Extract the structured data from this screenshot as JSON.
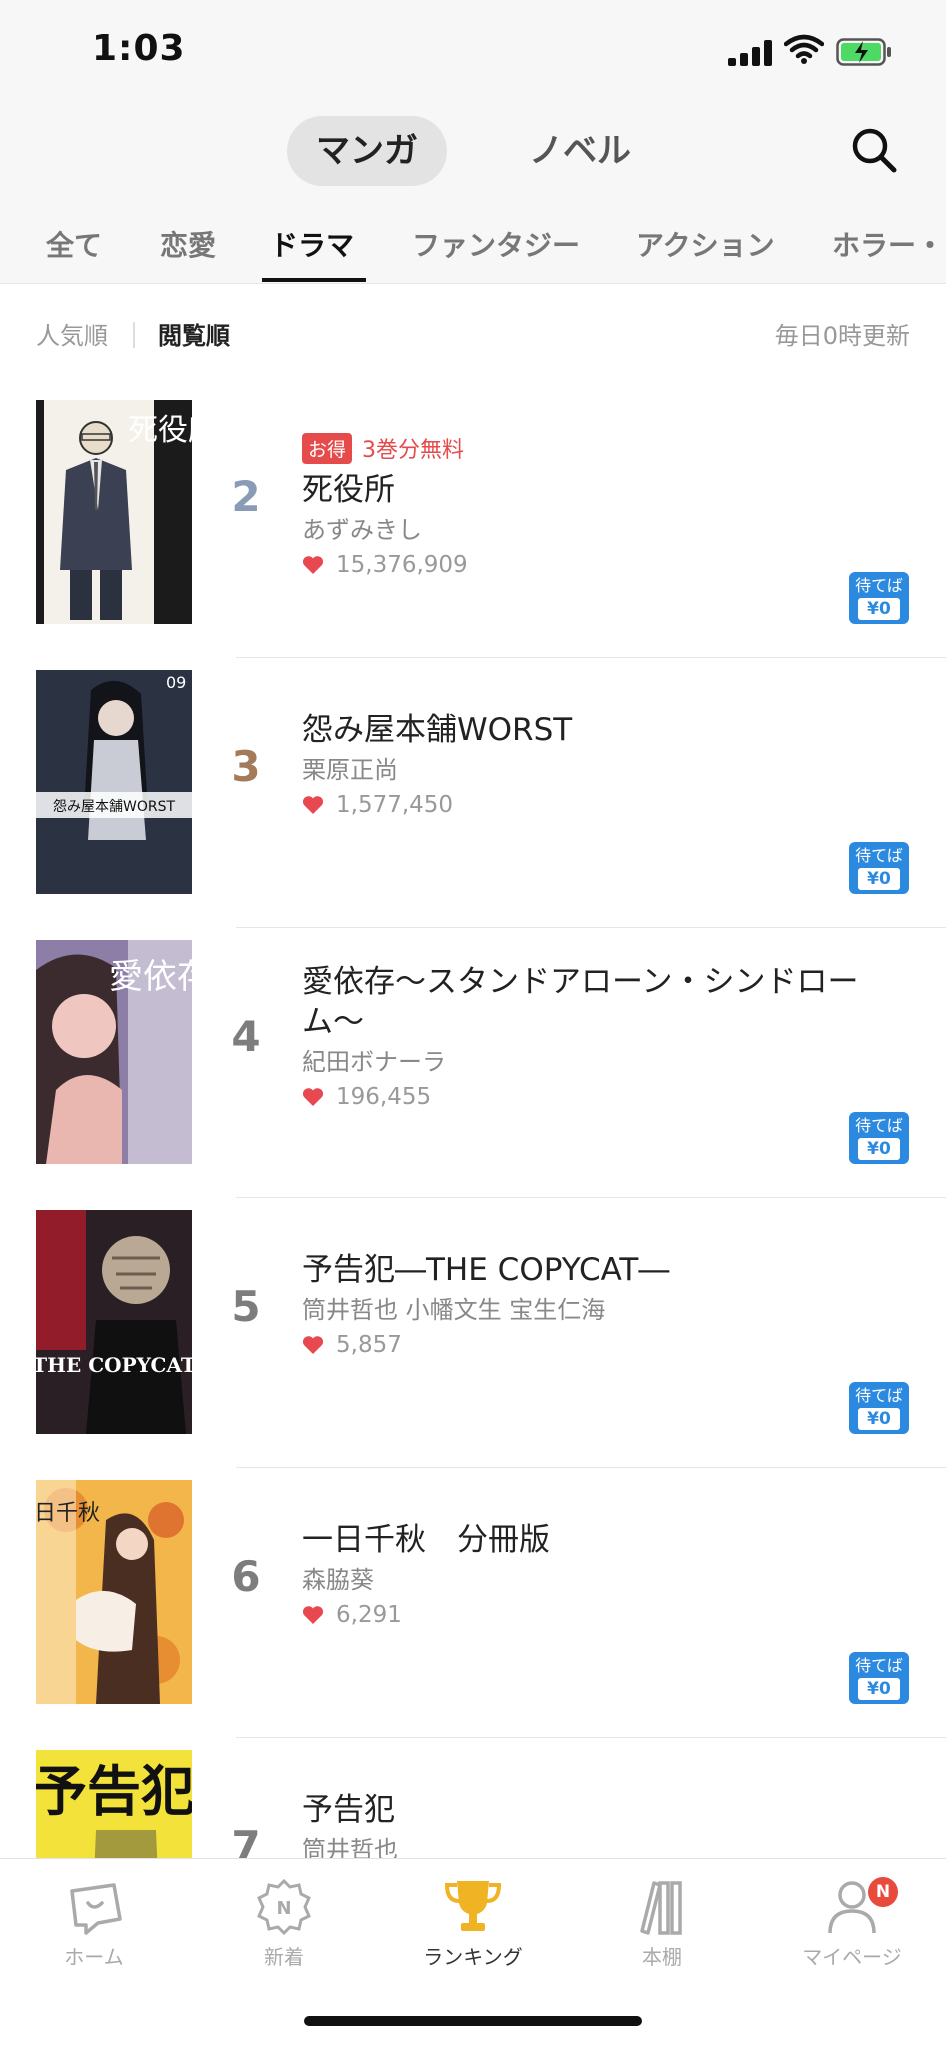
{
  "status_bar": {
    "time": "1:03"
  },
  "mode_tabs": {
    "active": "マンガ",
    "inactive": "ノベル"
  },
  "genres": [
    "全て",
    "恋愛",
    "ドラマ",
    "ファンタジー",
    "アクション",
    "ホラー・"
  ],
  "sort": {
    "popular": "人気順",
    "views": "閲覧順",
    "update_note": "毎日0時更新"
  },
  "wait_badge": {
    "line1": "待てば",
    "line2": "¥0"
  },
  "items": [
    {
      "rank": "2",
      "rank_color": "#8a9bb5",
      "deal_badge": "お得",
      "deal_text": "3巻分無料",
      "title": "死役所",
      "author": "あずみきし",
      "likes": "15,376,909",
      "cover_text": "死役所"
    },
    {
      "rank": "3",
      "rank_color": "#a37a5a",
      "title": "怨み屋本舗WORST",
      "author": "栗原正尚",
      "likes": "1,577,450",
      "cover_text": "怨み屋本舗WORST"
    },
    {
      "rank": "4",
      "rank_color": "#7d7d7d",
      "title": "愛依存〜スタンドアローン・シンドローム〜",
      "author": "紀田ボナーラ",
      "likes": "196,455",
      "cover_text": "愛依存"
    },
    {
      "rank": "5",
      "rank_color": "#7d7d7d",
      "title": "予告犯―THE COPYCAT―",
      "author": "筒井哲也 小幡文生 宝生仁海",
      "likes": "5,857",
      "cover_text": "THE COPYCAT"
    },
    {
      "rank": "6",
      "rank_color": "#7d7d7d",
      "title": "一日千秋　分冊版",
      "author": "森脇葵",
      "likes": "6,291",
      "cover_text": "一日千秋"
    },
    {
      "rank": "7",
      "rank_color": "#7d7d7d",
      "title": "予告犯",
      "author": "筒井哲也",
      "cover_text": "予告犯"
    }
  ],
  "bottom_nav": [
    {
      "label": "ホーム",
      "icon": "home-icon"
    },
    {
      "label": "新着",
      "icon": "new-icon"
    },
    {
      "label": "ランキング",
      "icon": "trophy-icon"
    },
    {
      "label": "本棚",
      "icon": "bookshelf-icon"
    },
    {
      "label": "マイページ",
      "icon": "user-icon",
      "badge": "N"
    }
  ],
  "colors": {
    "accent_red": "#e64b4b",
    "wait_blue": "#2c89e0",
    "trophy_gold": "#f0b323",
    "heart": "#e8484f"
  }
}
